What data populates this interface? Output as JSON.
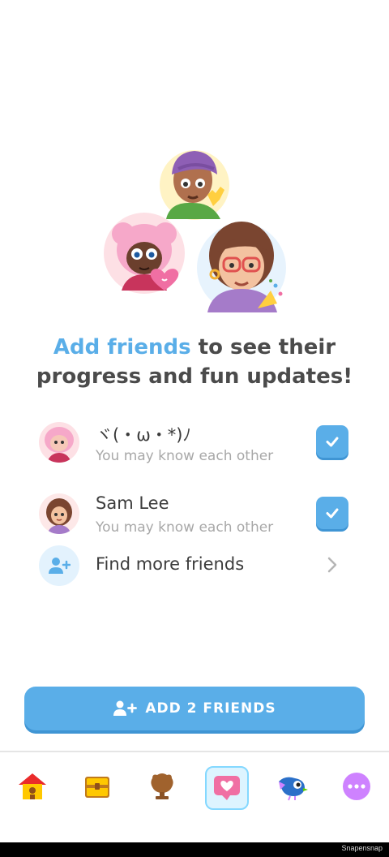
{
  "headline": {
    "highlight": "Add friends",
    "rest_line1": " to see their",
    "line2": "progress and fun updates!"
  },
  "friends": [
    {
      "name": "ヾ(・ω・*)ﾉ",
      "subtitle": "You may know each other",
      "selected": true
    },
    {
      "name": "Sam Lee",
      "subtitle": "You may know each other",
      "selected": true
    }
  ],
  "find_more": {
    "label": "Find more friends",
    "icon": "add-user-icon"
  },
  "cta": {
    "label": "ADD 2 FRIENDS",
    "icon": "add-user-icon"
  },
  "tabs": [
    {
      "name": "home",
      "icon": "home-icon",
      "active": false
    },
    {
      "name": "treasure",
      "icon": "treasure-chest-icon",
      "active": false
    },
    {
      "name": "leaderboard",
      "icon": "trophy-icon",
      "active": false
    },
    {
      "name": "friends",
      "icon": "heart-bubble-icon",
      "active": true
    },
    {
      "name": "practice",
      "icon": "bird-icon",
      "active": false
    },
    {
      "name": "more",
      "icon": "more-icon",
      "active": false
    }
  ],
  "watermark": "Snapensnap",
  "colors": {
    "accent": "#5aaee8",
    "accent_shadow": "#3f95d4",
    "muted": "#a8a8a8"
  }
}
